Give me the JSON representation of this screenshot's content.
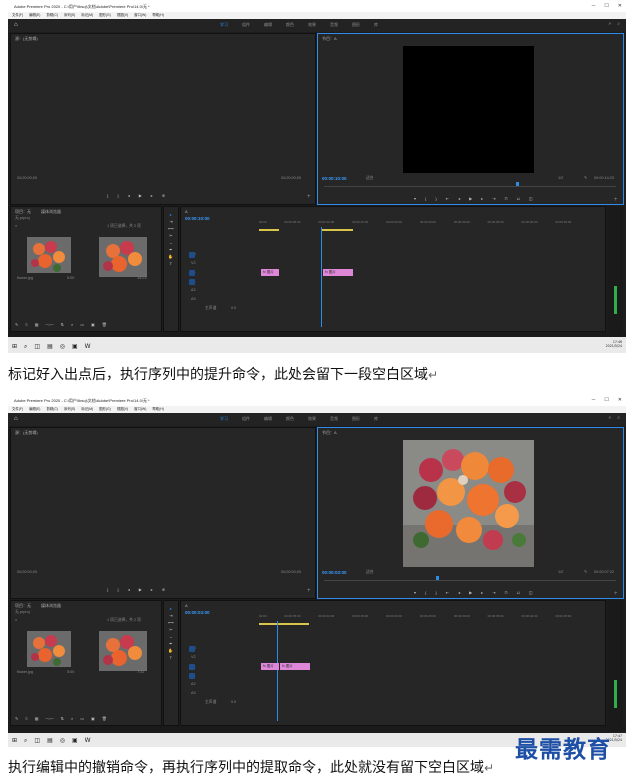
{
  "screenshots": [
    {
      "window_title": "Adobe Premiere Pro 2020 - C:\\用户\\Ibsoj\\文档\\Adobe\\Premiere Pro\\14.0\\无 *",
      "menu": [
        "文件(F)",
        "编辑(E)",
        "剪辑(C)",
        "序列(S)",
        "标记(M)",
        "图形(G)",
        "视图(V)",
        "窗口(W)",
        "帮助(H)"
      ],
      "workspace_tabs": [
        "学习",
        "组件",
        "编辑",
        "颜色",
        "效果",
        "音频",
        "图形",
        "库"
      ],
      "active_tab": "学习",
      "source_title": "源：(无剪辑)",
      "source_tc_left": "00;00;00;00",
      "source_tc_right": "00;00;00;00",
      "program_title": "节目：A",
      "program_tc": "00:00:10:00",
      "program_fit": "适合",
      "program_ratio": "1/2",
      "program_tc_right": "00:00:14:23",
      "program_shows_image": false,
      "project_title": "项目：无",
      "media_browser": "媒体浏览器",
      "project_file": "无.prproj",
      "project_count": "1 项已选择，共 2 项",
      "bin_items": [
        {
          "name": "flower.jpg",
          "dur": "5:00"
        },
        {
          "name": "A",
          "dur": "14:23"
        }
      ],
      "timeline_title": "A",
      "timeline_tc": "00:00:10:00",
      "ruler": [
        "00:00",
        "00:00:05:00",
        "00:00:10:00",
        "00:00:15:00",
        "00:00:20:00",
        "00:00:25:00",
        "00:00:30:00",
        "00:00:35:00",
        "00:00:40:00",
        "00:00:45:00"
      ],
      "tracks": [
        "V3",
        "V2",
        "V1",
        "A1",
        "A2",
        "A3",
        "主声道"
      ],
      "master_value": "0.0",
      "clips": [
        "fx 图片",
        "fx 图片"
      ],
      "sys_time": "17:46",
      "sys_date": "2021/5/24"
    },
    {
      "window_title": "Adobe Premiere Pro 2020 - C:\\用户\\Ibsoj\\文档\\Adobe\\Premiere Pro\\14.0\\无 *",
      "menu": [
        "文件(F)",
        "编辑(E)",
        "剪辑(C)",
        "序列(S)",
        "标记(M)",
        "图形(G)",
        "视图(V)",
        "窗口(W)",
        "帮助(H)"
      ],
      "workspace_tabs": [
        "学习",
        "组件",
        "编辑",
        "颜色",
        "效果",
        "音频",
        "图形",
        "库"
      ],
      "active_tab": "学习",
      "source_title": "源：(无剪辑)",
      "source_tc_left": "00;00;00;00",
      "source_tc_right": "00;00;00;00",
      "program_title": "节目：A",
      "program_tc": "00:00:03:00",
      "program_fit": "适合",
      "program_ratio": "1/2",
      "program_tc_right": "00:00:07:22",
      "program_shows_image": true,
      "project_title": "项目：无",
      "media_browser": "媒体浏览器",
      "project_file": "无.prproj",
      "project_count": "1 项已选择，共 2 项",
      "bin_items": [
        {
          "name": "flower.jpg",
          "dur": "5:00"
        },
        {
          "name": "A",
          "dur": "7:22"
        }
      ],
      "timeline_title": "A",
      "timeline_tc": "00:00:03:00",
      "ruler": [
        "00:00",
        "00:00:05:00",
        "00:00:10:00",
        "00:00:15:00",
        "00:00:20:00",
        "00:00:25:00",
        "00:00:30:00",
        "00:00:35:00",
        "00:00:40:00",
        "00:00:45:00"
      ],
      "tracks": [
        "V3",
        "V2",
        "V1",
        "A1",
        "A2",
        "A3",
        "主声道"
      ],
      "master_value": "0.0",
      "clips": [
        "fx 图片",
        "fx 图片"
      ],
      "sys_time": "17:47",
      "sys_date": "2021/5/24"
    }
  ],
  "captions": [
    "标记好入出点后，执行序列中的提升命令，此处会留下一段空白区域",
    "执行编辑中的撤销命令，再执行序列中的提取命令，此处就没有留下空白区域"
  ],
  "watermark": "最需教育",
  "colors": {
    "accent": "#2d8ceb",
    "clip": "#de86d8",
    "panel": "#262626"
  }
}
